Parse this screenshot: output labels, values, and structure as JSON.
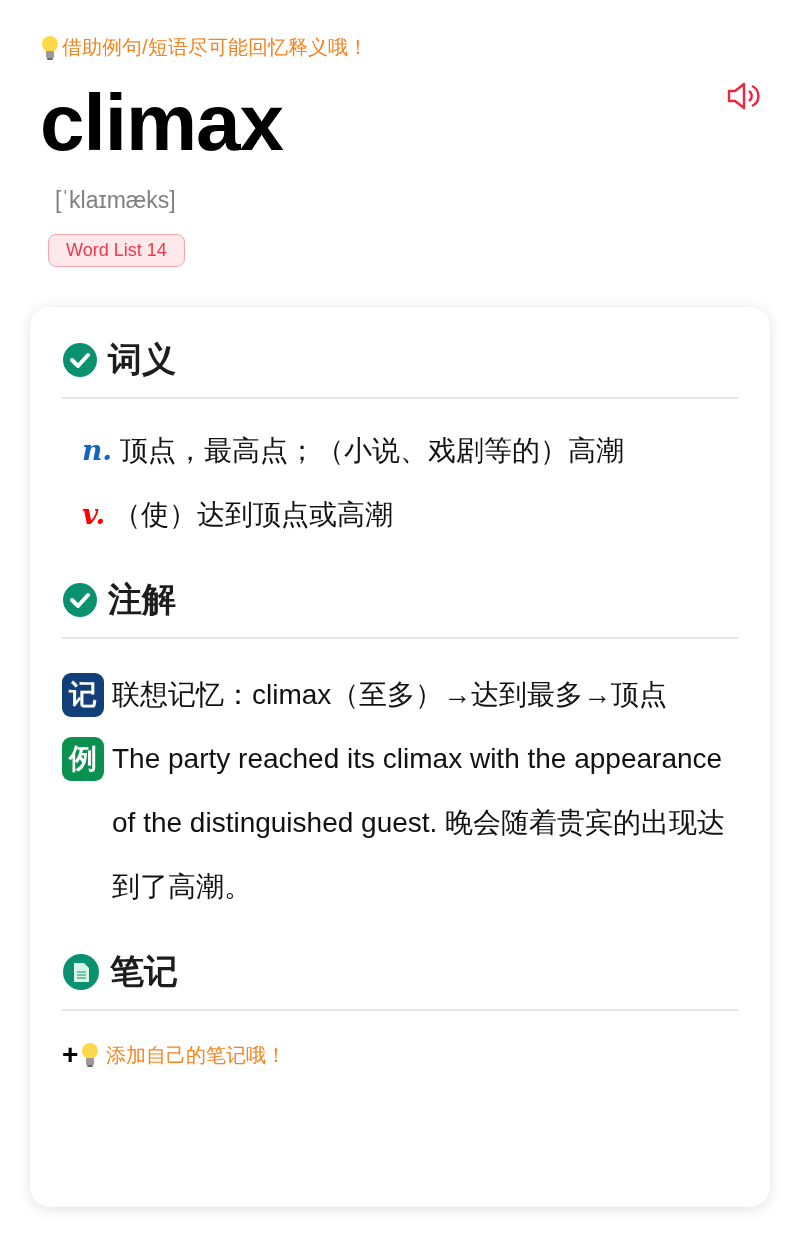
{
  "hint": "借助例句/短语尽可能回忆释义哦！",
  "word": "climax",
  "phonetic": "[ˈklaɪmæks]",
  "tag": "Word List 14",
  "sections": [
    {
      "kind": "check",
      "title": "词义",
      "meanings": [
        {
          "pos": "n.",
          "color": "#1565c0",
          "text": "顶点，最高点；（小说、戏剧等的）高潮"
        },
        {
          "pos": "v.",
          "color": "#ff0000",
          "text": "（使）达到顶点或高潮"
        }
      ]
    },
    {
      "kind": "check",
      "title": "注解",
      "notes": [
        {
          "kind": "memory",
          "badge": "记",
          "text": "联想记忆：climax（至多）→达到最多→顶点"
        },
        {
          "kind": "example",
          "badge": "例",
          "text": "The party reached its climax with the appearance of the distinguished guest. 晚会随着贵宾的出现达到了高潮。"
        }
      ]
    },
    {
      "kind": "note",
      "title": "笔记",
      "add": {
        "symbol": "+",
        "hint": "添加自己的笔记哦！"
      }
    }
  ]
}
